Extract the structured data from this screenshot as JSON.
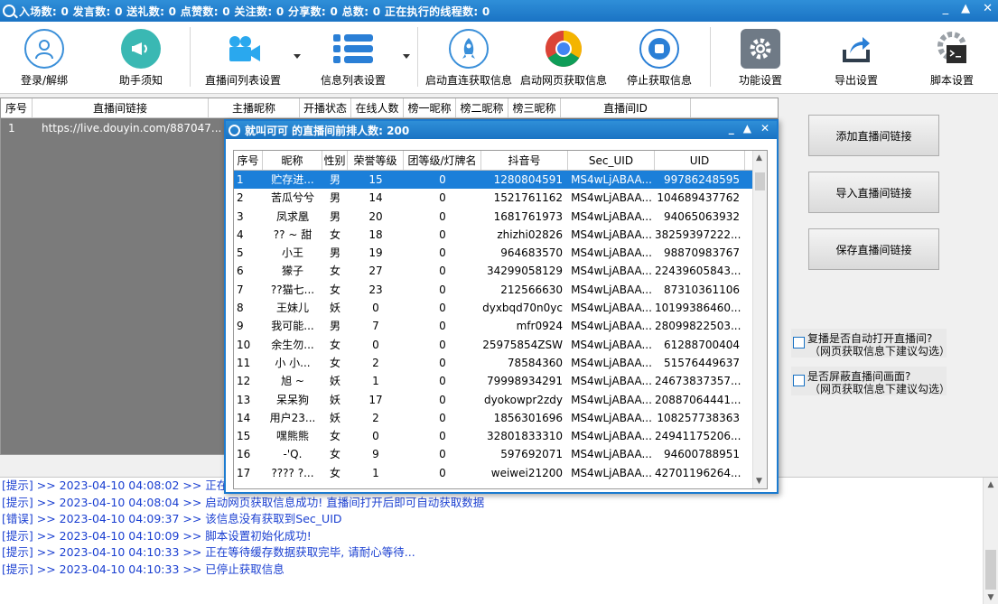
{
  "titlebar": {
    "stats": "入场数: 0  发言数: 0  送礼数: 0  点赞数: 0  关注数: 0  分享数: 0  总数: 0  正在执行的线程数: 0",
    "minimize": "_",
    "maximize": "▲",
    "close": "✕"
  },
  "toolbar": {
    "login": "登录/解绑",
    "help": "助手须知",
    "live_list_settings": "直播间列表设置",
    "info_list_settings": "信息列表设置",
    "start_direct": "启动直连获取信息",
    "start_web": "启动网页获取信息",
    "stop": "停止获取信息",
    "function_settings": "功能设置",
    "export_settings": "导出设置",
    "script_settings": "脚本设置"
  },
  "main_list": {
    "headers": [
      "序号",
      "直播间链接",
      "主播昵称",
      "开播状态",
      "在线人数",
      "榜一昵称",
      "榜二昵称",
      "榜三昵称",
      "直播间ID"
    ],
    "rows": [
      {
        "idx": "1",
        "link": "https://live.douyin.com/887047..."
      }
    ]
  },
  "right_panel": {
    "add_link": "添加直播间链接",
    "import_link": "导入直播间链接",
    "save_link": "保存直播间链接",
    "check1_title": "复播是否自动打开直播间?",
    "check1_hint": "（网页获取信息下建议勾选）",
    "check2_title": "是否屏蔽直播间画面?",
    "check2_hint": "（网页获取信息下建议勾选）"
  },
  "popup": {
    "title": "就叫可可 的直播间前排人数: 200",
    "minimize": "_",
    "maximize": "▲",
    "close": "✕",
    "headers": [
      "序号",
      "昵称",
      "性别",
      "荣誉等级",
      "团等级/灯牌名",
      "抖音号",
      "Sec_UID",
      "UID"
    ],
    "rows": [
      [
        "1",
        "贮存进...",
        "男",
        "15",
        "0",
        "1280804591",
        "MS4wLjABAA...",
        "99786248595"
      ],
      [
        "2",
        "苦瓜兮兮",
        "男",
        "14",
        "0",
        "1521761162",
        "MS4wLjABAA...",
        "104689437762"
      ],
      [
        "3",
        "凤求凰",
        "男",
        "20",
        "0",
        "1681761973",
        "MS4wLjABAA...",
        "94065063932"
      ],
      [
        "4",
        "?? ~ 甜",
        "女",
        "18",
        "0",
        "zhizhi02826",
        "MS4wLjABAA...",
        "38259397222..."
      ],
      [
        "5",
        "小王",
        "男",
        "19",
        "0",
        "964683570",
        "MS4wLjABAA...",
        "98870983767"
      ],
      [
        "6",
        "獴子",
        "女",
        "27",
        "0",
        "34299058129",
        "MS4wLjABAA...",
        "22439605843..."
      ],
      [
        "7",
        "??猫七...",
        "女",
        "23",
        "0",
        "212566630",
        "MS4wLjABAA...",
        "87310361106"
      ],
      [
        "8",
        "王妹儿",
        "妖",
        "0",
        "0",
        "dyxbqd70n0yc",
        "MS4wLjABAA...",
        "10199386460..."
      ],
      [
        "9",
        "我可能...",
        "男",
        "7",
        "0",
        "mfr0924",
        "MS4wLjABAA...",
        "28099822503..."
      ],
      [
        "10",
        "余生勿...",
        "女",
        "0",
        "0",
        "25975854ZSW",
        "MS4wLjABAA...",
        "61288700404"
      ],
      [
        "11",
        "小 小...",
        "女",
        "2",
        "0",
        "78584360",
        "MS4wLjABAA...",
        "51576449637"
      ],
      [
        "12",
        "旭 ~",
        "妖",
        "1",
        "0",
        "79998934291",
        "MS4wLjABAA...",
        "24673837357..."
      ],
      [
        "13",
        "呆呆狗",
        "妖",
        "17",
        "0",
        "dyokowpr2zdy",
        "MS4wLjABAA...",
        "20887064441..."
      ],
      [
        "14",
        "用户23...",
        "妖",
        "2",
        "0",
        "1856301696",
        "MS4wLjABAA...",
        "108257738363"
      ],
      [
        "15",
        "嘿熊熊",
        "女",
        "0",
        "0",
        "32801833310",
        "MS4wLjABAA...",
        "24941175206..."
      ],
      [
        "16",
        "-'Q.",
        "女",
        "9",
        "0",
        "597692071",
        "MS4wLjABAA...",
        "94600788951"
      ],
      [
        "17",
        "???? ?...",
        "女",
        "1",
        "0",
        "weiwei21200",
        "MS4wLjABAA...",
        "42701196264..."
      ]
    ]
  },
  "log": {
    "lines": [
      "[提示] >> 2023-04-10 04:08:02 >> 正在启",
      "[提示] >> 2023-04-10 04:08:04 >> 启动网页获取信息成功! 直播间打开后即可自动获取数据",
      "[错误] >> 2023-04-10 04:09:37 >> 该信息没有获取到Sec_UID",
      "[提示] >> 2023-04-10 04:10:09 >> 脚本设置初始化成功!",
      "[提示] >> 2023-04-10 04:10:33 >> 正在等待缓存数据获取完毕, 请耐心等待...",
      "[提示] >> 2023-04-10 04:10:33 >> 已停止获取信息"
    ]
  },
  "colors": {
    "accent": "#1a73c4",
    "selected_row": "#1b7fd9",
    "log_text": "#1a3fd1"
  }
}
